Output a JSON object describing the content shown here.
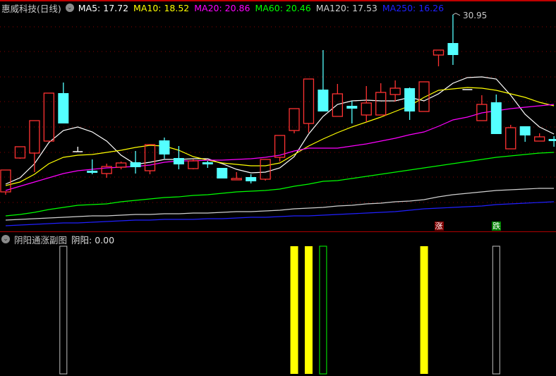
{
  "header": {
    "title": "惠威科技(日线)",
    "ma_labels": [
      {
        "name": "MA5",
        "text": "MA5: 17.72",
        "color": "#ffffff"
      },
      {
        "name": "MA10",
        "text": "MA10: 18.52",
        "color": "#ffff00"
      },
      {
        "name": "MA20",
        "text": "MA20: 20.86",
        "color": "#ff00ff"
      },
      {
        "name": "MA60",
        "text": "MA60: 20.46",
        "color": "#00ff00"
      },
      {
        "name": "MA120",
        "text": "MA120: 17.53",
        "color": "#d0d0d0"
      },
      {
        "name": "MA250",
        "text": "MA250: 16.26",
        "color": "#2020ff"
      }
    ]
  },
  "sub_panel": {
    "title": "阴阳通涨副图",
    "value_label": "阴阳: 0.00"
  },
  "signals": {
    "rise": {
      "text": "涨",
      "index": 30,
      "color": "#800000"
    },
    "fall": {
      "text": "跌",
      "index": 34,
      "color": "#008000"
    }
  },
  "colors": {
    "up": "#ff3232",
    "down": "#54ffff",
    "doji": "#ffffff",
    "grid": "#8b0000"
  },
  "chart_data": [
    {
      "type": "candlestick",
      "title": "惠威科技(日线)",
      "ylim": [
        12.4,
        32.2
      ],
      "high_annotation": {
        "text": "30.95",
        "index": 31
      },
      "candles": [
        [
          15.88,
          17.74,
          15.64,
          17.74
        ],
        [
          18.76,
          19.72,
          18.7,
          19.72
        ],
        [
          19.18,
          21.94,
          17.56,
          21.94
        ],
        [
          20.2,
          24.28,
          20.2,
          24.28
        ],
        [
          24.28,
          25.18,
          21.7,
          21.7
        ],
        [
          19.3,
          19.72,
          19.3,
          19.3
        ],
        [
          17.68,
          18.64,
          17.38,
          17.5
        ],
        [
          17.44,
          18.28,
          17.08,
          18.04
        ],
        [
          17.98,
          18.46,
          17.8,
          18.34
        ],
        [
          18.4,
          19.36,
          17.44,
          17.98
        ],
        [
          17.68,
          19.9,
          17.38,
          19.9
        ],
        [
          20.26,
          20.5,
          18.7,
          19.06
        ],
        [
          18.76,
          19.78,
          17.8,
          18.22
        ],
        [
          17.86,
          18.64,
          17.8,
          18.52
        ],
        [
          18.4,
          18.52,
          17.92,
          18.22
        ],
        [
          17.92,
          17.92,
          17.02,
          17.02
        ],
        [
          16.9,
          17.56,
          16.9,
          17.02
        ],
        [
          17.14,
          17.38,
          16.6,
          16.78
        ],
        [
          16.96,
          18.64,
          16.84,
          18.64
        ],
        [
          18.82,
          20.68,
          18.46,
          20.68
        ],
        [
          21.1,
          22.96,
          20.86,
          22.96
        ],
        [
          21.7,
          25.48,
          20.92,
          25.48
        ],
        [
          24.58,
          27.94,
          22.72,
          22.72
        ],
        [
          22.3,
          25.06,
          22.3,
          24.22
        ],
        [
          23.2,
          23.62,
          21.7,
          22.96
        ],
        [
          22.42,
          24.88,
          21.82,
          23.44
        ],
        [
          22.42,
          25.12,
          22.42,
          24.34
        ],
        [
          24.16,
          25.36,
          23.56,
          24.7
        ],
        [
          24.7,
          24.76,
          22.0,
          22.72
        ],
        [
          22.72,
          25.24,
          22.72,
          25.24
        ],
        [
          27.52,
          27.94,
          26.56,
          27.94
        ],
        [
          28.54,
          30.95,
          26.68,
          27.52
        ],
        [
          24.58,
          24.58,
          24.58,
          24.58
        ],
        [
          21.94,
          24.1,
          21.94,
          23.32
        ],
        [
          23.5,
          24.16,
          20.8,
          20.8
        ],
        [
          19.54,
          21.58,
          19.54,
          21.34
        ],
        [
          21.46,
          21.46,
          20.14,
          20.68
        ],
        [
          20.2,
          20.86,
          20.2,
          20.56
        ],
        [
          20.38,
          20.62,
          19.72,
          20.2
        ]
      ],
      "candle_format": [
        "open",
        "high",
        "low",
        "close"
      ],
      "series": [
        {
          "name": "MA5",
          "color": "#ffffff",
          "values": [
            16.54,
            17.08,
            18.28,
            20.08,
            21.1,
            21.4,
            20.98,
            20.2,
            19.0,
            18.22,
            18.4,
            18.64,
            18.64,
            18.7,
            18.7,
            18.28,
            17.8,
            17.5,
            17.56,
            17.92,
            18.88,
            20.8,
            22.3,
            23.32,
            23.62,
            23.68,
            23.62,
            23.62,
            23.92,
            23.62,
            24.22,
            25.12,
            25.6,
            25.66,
            25.48,
            24.1,
            22.48,
            21.4,
            20.8
          ]
        },
        {
          "name": "MA10",
          "color": "#ffff00",
          "values": [
            16.42,
            16.72,
            17.38,
            18.28,
            18.82,
            19.0,
            19.06,
            19.24,
            19.42,
            19.66,
            19.84,
            19.78,
            19.42,
            18.88,
            18.58,
            18.34,
            18.22,
            18.1,
            18.1,
            18.34,
            19.06,
            19.78,
            20.38,
            20.92,
            21.4,
            21.82,
            22.24,
            22.72,
            23.2,
            23.92,
            24.52,
            24.64,
            24.76,
            24.7,
            24.52,
            24.22,
            23.92,
            23.5,
            23.2
          ]
        },
        {
          "name": "MA20",
          "color": "#ff00ff",
          "values": [
            16.0,
            16.36,
            16.72,
            17.08,
            17.44,
            17.68,
            17.8,
            17.92,
            17.98,
            18.04,
            18.16,
            18.4,
            18.52,
            18.52,
            18.58,
            18.58,
            18.64,
            18.7,
            18.82,
            19.0,
            19.36,
            19.6,
            19.6,
            19.6,
            19.78,
            19.96,
            20.2,
            20.44,
            20.74,
            20.98,
            21.46,
            22.0,
            22.24,
            22.6,
            22.78,
            22.96,
            23.08,
            23.2,
            23.32
          ]
        },
        {
          "name": "MA60",
          "color": "#00ff00",
          "values": [
            13.84,
            13.96,
            14.14,
            14.38,
            14.56,
            14.74,
            14.8,
            14.86,
            15.04,
            15.16,
            15.28,
            15.4,
            15.46,
            15.58,
            15.64,
            15.76,
            15.88,
            15.94,
            16.0,
            16.12,
            16.36,
            16.54,
            16.78,
            16.84,
            17.02,
            17.2,
            17.38,
            17.56,
            17.74,
            17.92,
            18.1,
            18.28,
            18.46,
            18.64,
            18.82,
            18.94,
            19.06,
            19.18,
            19.24
          ]
        },
        {
          "name": "MA120",
          "color": "#d0d0d0",
          "values": [
            13.48,
            13.54,
            13.6,
            13.66,
            13.72,
            13.78,
            13.84,
            13.84,
            13.9,
            13.96,
            13.96,
            14.02,
            14.02,
            14.08,
            14.08,
            14.14,
            14.2,
            14.2,
            14.26,
            14.32,
            14.44,
            14.5,
            14.56,
            14.68,
            14.74,
            14.86,
            14.92,
            15.04,
            15.1,
            15.22,
            15.46,
            15.64,
            15.76,
            15.88,
            16.0,
            16.06,
            16.12,
            16.18,
            16.18
          ]
        },
        {
          "name": "MA250",
          "color": "#2020ff",
          "values": [
            13.0,
            13.06,
            13.12,
            13.18,
            13.24,
            13.24,
            13.3,
            13.36,
            13.42,
            13.48,
            13.48,
            13.54,
            13.54,
            13.54,
            13.6,
            13.6,
            13.66,
            13.72,
            13.72,
            13.78,
            13.84,
            13.84,
            13.9,
            13.96,
            14.02,
            14.08,
            14.14,
            14.2,
            14.32,
            14.44,
            14.5,
            14.56,
            14.62,
            14.68,
            14.8,
            14.86,
            14.92,
            14.98,
            15.04
          ]
        }
      ]
    },
    {
      "type": "bar",
      "title": "阴阳通涨副图",
      "ylim": [
        0,
        1
      ],
      "bars": [
        {
          "index": 4,
          "value": 1,
          "color": "#c0c0c0",
          "style": "hollow"
        },
        {
          "index": 20,
          "value": 1,
          "color": "#ffff00",
          "style": "filled"
        },
        {
          "index": 21,
          "value": 1,
          "color": "#ffff00",
          "style": "filled"
        },
        {
          "index": 22,
          "value": 1,
          "color": "#00ff00",
          "style": "hollow"
        },
        {
          "index": 29,
          "value": 1,
          "color": "#ffff00",
          "style": "filled"
        },
        {
          "index": 34,
          "value": 1,
          "color": "#c0c0c0",
          "style": "hollow"
        }
      ]
    }
  ]
}
